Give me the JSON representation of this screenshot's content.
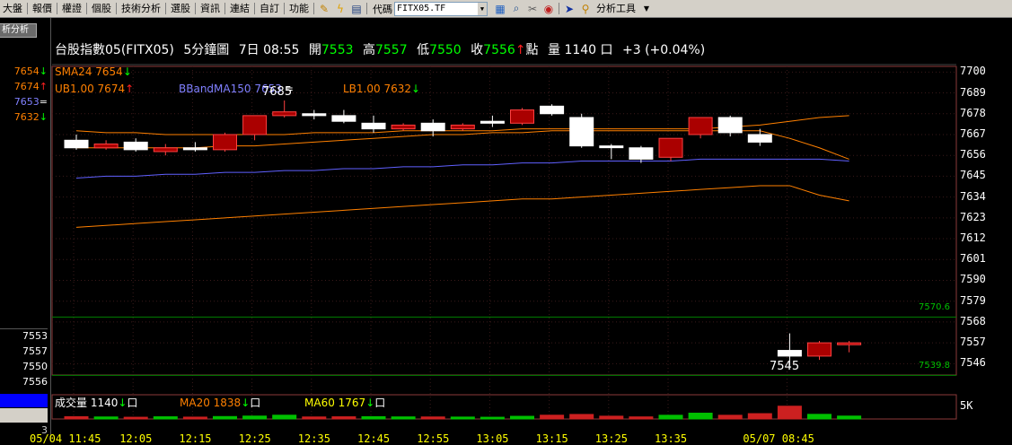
{
  "menubar": {
    "items": [
      "大盤",
      "報價",
      "權證",
      "個股",
      "技術分析",
      "選股",
      "資訊",
      "連結",
      "自訂",
      "功能"
    ],
    "code_label": "代碼",
    "code_value": "FITX05.TF",
    "tools_label": "分析工具"
  },
  "leftpanel": {
    "tab_label": "析分析",
    "top_values": [
      {
        "text": "7654",
        "arrow": "↓",
        "color": "#ff8000"
      },
      {
        "text": "7674",
        "arrow": "↑",
        "color": "#ff8000"
      },
      {
        "text": "7653",
        "arrow": "=",
        "color": "#8080ff"
      },
      {
        "text": "7632",
        "arrow": "↓",
        "color": "#ff8000"
      }
    ],
    "quote_values": [
      "7553",
      "7557",
      "7550",
      "7556"
    ],
    "bottom_number": "3"
  },
  "header": {
    "name": "台股指數05(FITX05)",
    "period": "5分鐘圖",
    "time": "7日 08:55",
    "open_label": "開",
    "open": "7553",
    "high_label": "高",
    "high": "7557",
    "low_label": "低",
    "low": "7550",
    "close_label": "收",
    "close": "7556",
    "close_arrow": "↑",
    "points_label": "點",
    "vol_label": "量",
    "vol": "1140",
    "vol_box": "口",
    "change": "+3 (+0.04%)"
  },
  "indicators": {
    "sma": "SMA24 7654",
    "sma_arrow": "↓",
    "ub": "UB1.00 7674",
    "ub_arrow": "↑",
    "bband": "BBandMA150 7653",
    "bband_sign": "=",
    "lb": "LB1.00 7632",
    "lb_arrow": "↓",
    "vol": "成交量 1140",
    "vol_arrow": "↓",
    "ma20": "MA20 1838",
    "ma20_arrow": "↓",
    "ma60": "MA60 1767",
    "ma60_arrow": "↓",
    "box": "口"
  },
  "annotations": {
    "high_label": "7685",
    "low_label": "7545",
    "line_upper": "7570.6",
    "line_lower": "7539.8"
  },
  "y_ticks": [
    "7700",
    "7689",
    "7678",
    "7667",
    "7656",
    "7645",
    "7634",
    "7623",
    "7612",
    "7601",
    "7590",
    "7579",
    "7568",
    "7557",
    "7546"
  ],
  "vol_tick": "5K",
  "x_ticks": [
    "05/04 11:45",
    "12:05",
    "12:15",
    "12:25",
    "12:35",
    "12:45",
    "12:55",
    "13:05",
    "13:15",
    "13:25",
    "13:35",
    "05/07 08:45"
  ],
  "colors": {
    "up": "#aa0000",
    "down": "#ffffff",
    "sma": "#ff8000",
    "bband": "#6060ff",
    "grid": "#8b3a3a"
  },
  "chart_data": {
    "type": "candlestick",
    "y_range": [
      7540,
      7703
    ],
    "candles": [
      {
        "o": 7664,
        "h": 7667,
        "l": 7659,
        "c": 7660
      },
      {
        "o": 7660,
        "h": 7664,
        "l": 7659,
        "c": 7662
      },
      {
        "o": 7663,
        "h": 7665,
        "l": 7658,
        "c": 7659
      },
      {
        "o": 7658,
        "h": 7662,
        "l": 7656,
        "c": 7660
      },
      {
        "o": 7660,
        "h": 7663,
        "l": 7658,
        "c": 7659
      },
      {
        "o": 7659,
        "h": 7668,
        "l": 7658,
        "c": 7667
      },
      {
        "o": 7667,
        "h": 7677,
        "l": 7664,
        "c": 7677
      },
      {
        "o": 7677,
        "h": 7685,
        "l": 7676,
        "c": 7679
      },
      {
        "o": 7678,
        "h": 7680,
        "l": 7675,
        "c": 7677
      },
      {
        "o": 7677,
        "h": 7680,
        "l": 7673,
        "c": 7674
      },
      {
        "o": 7673,
        "h": 7677,
        "l": 7668,
        "c": 7670
      },
      {
        "o": 7670,
        "h": 7673,
        "l": 7669,
        "c": 7672
      },
      {
        "o": 7673,
        "h": 7675,
        "l": 7666,
        "c": 7669
      },
      {
        "o": 7670,
        "h": 7673,
        "l": 7669,
        "c": 7672
      },
      {
        "o": 7674,
        "h": 7677,
        "l": 7671,
        "c": 7673
      },
      {
        "o": 7673,
        "h": 7681,
        "l": 7672,
        "c": 7680
      },
      {
        "o": 7682,
        "h": 7683,
        "l": 7677,
        "c": 7678
      },
      {
        "o": 7676,
        "h": 7678,
        "l": 7660,
        "c": 7661
      },
      {
        "o": 7661,
        "h": 7662,
        "l": 7654,
        "c": 7661
      },
      {
        "o": 7660,
        "h": 7661,
        "l": 7652,
        "c": 7654
      },
      {
        "o": 7655,
        "h": 7665,
        "l": 7653,
        "c": 7665
      },
      {
        "o": 7667,
        "h": 7676,
        "l": 7665,
        "c": 7676
      },
      {
        "o": 7676,
        "h": 7677,
        "l": 7666,
        "c": 7668
      },
      {
        "o": 7667,
        "h": 7670,
        "l": 7661,
        "c": 7663
      },
      {
        "o": 7553,
        "h": 7562,
        "l": 7545,
        "c": 7550
      },
      {
        "o": 7550,
        "h": 7558,
        "l": 7548,
        "c": 7557
      },
      {
        "o": 7556,
        "h": 7558,
        "l": 7552,
        "c": 7557
      }
    ],
    "upper_band": [
      7669,
      7668,
      7668,
      7667,
      7667,
      7667,
      7667,
      7667,
      7668,
      7668,
      7668,
      7669,
      7669,
      7669,
      7669,
      7670,
      7670,
      7670,
      7670,
      7670,
      7670,
      7670,
      7671,
      7672,
      7674,
      7676,
      7677
    ],
    "lower_band": [
      7618,
      7619,
      7620,
      7621,
      7622,
      7623,
      7624,
      7625,
      7626,
      7627,
      7628,
      7629,
      7630,
      7631,
      7632,
      7633,
      7633,
      7634,
      7635,
      7636,
      7637,
      7638,
      7639,
      7640,
      7640,
      7635,
      7632
    ],
    "ma150": [
      7644,
      7645,
      7645,
      7646,
      7646,
      7647,
      7647,
      7648,
      7648,
      7649,
      7649,
      7650,
      7650,
      7651,
      7651,
      7652,
      7652,
      7653,
      7653,
      7653,
      7653,
      7654,
      7654,
      7654,
      7654,
      7654,
      7653
    ],
    "sma24": [
      7660,
      7660,
      7660,
      7660,
      7660,
      7661,
      7661,
      7662,
      7663,
      7664,
      7665,
      7666,
      7667,
      7667,
      7668,
      7668,
      7669,
      7669,
      7669,
      7669,
      7669,
      7669,
      7669,
      7669,
      7665,
      7660,
      7654
    ],
    "volumes": [
      {
        "v": 400,
        "up": false
      },
      {
        "v": 350,
        "up": true
      },
      {
        "v": 300,
        "up": false
      },
      {
        "v": 380,
        "up": true
      },
      {
        "v": 320,
        "up": false
      },
      {
        "v": 420,
        "up": true
      },
      {
        "v": 500,
        "up": true
      },
      {
        "v": 650,
        "up": true
      },
      {
        "v": 350,
        "up": false
      },
      {
        "v": 380,
        "up": false
      },
      {
        "v": 400,
        "up": true
      },
      {
        "v": 360,
        "up": true
      },
      {
        "v": 350,
        "up": false
      },
      {
        "v": 330,
        "up": true
      },
      {
        "v": 300,
        "up": true
      },
      {
        "v": 460,
        "up": true
      },
      {
        "v": 650,
        "up": false
      },
      {
        "v": 780,
        "up": false
      },
      {
        "v": 480,
        "up": false
      },
      {
        "v": 360,
        "up": false
      },
      {
        "v": 640,
        "up": true
      },
      {
        "v": 1000,
        "up": true
      },
      {
        "v": 640,
        "up": false
      },
      {
        "v": 920,
        "up": false
      },
      {
        "v": 2200,
        "up": false
      },
      {
        "v": 800,
        "up": true
      },
      {
        "v": 500,
        "up": true
      }
    ],
    "vol_max": 5000
  }
}
